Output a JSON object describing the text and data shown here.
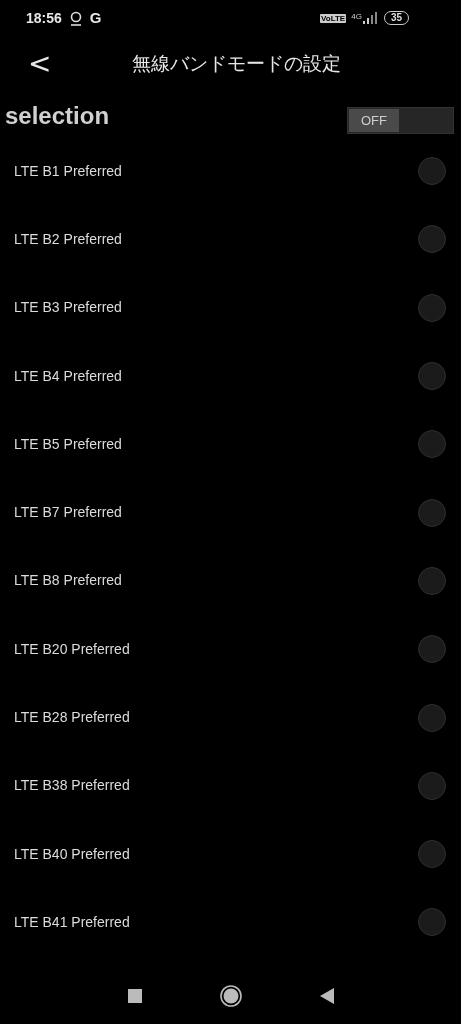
{
  "status_bar": {
    "time": "18:56",
    "carrier_letter": "G",
    "volte": "VoLTE",
    "network": "4G",
    "battery": "35"
  },
  "header": {
    "back": "<",
    "title": "無線バンドモードの設定"
  },
  "selection": {
    "label": "selection",
    "toggle": {
      "label": "OFF",
      "on": false
    }
  },
  "bands": [
    {
      "label": "LTE B1 Preferred",
      "selected": false
    },
    {
      "label": "LTE B2 Preferred",
      "selected": false
    },
    {
      "label": "LTE B3 Preferred",
      "selected": false
    },
    {
      "label": "LTE B4 Preferred",
      "selected": false
    },
    {
      "label": "LTE B5 Preferred",
      "selected": false
    },
    {
      "label": "LTE B7 Preferred",
      "selected": false
    },
    {
      "label": "LTE B8 Preferred",
      "selected": false
    },
    {
      "label": "LTE B20 Preferred",
      "selected": false
    },
    {
      "label": "LTE B28 Preferred",
      "selected": false
    },
    {
      "label": "LTE B38 Preferred",
      "selected": false
    },
    {
      "label": "LTE B40 Preferred",
      "selected": false
    },
    {
      "label": "LTE B41 Preferred",
      "selected": false
    }
  ]
}
